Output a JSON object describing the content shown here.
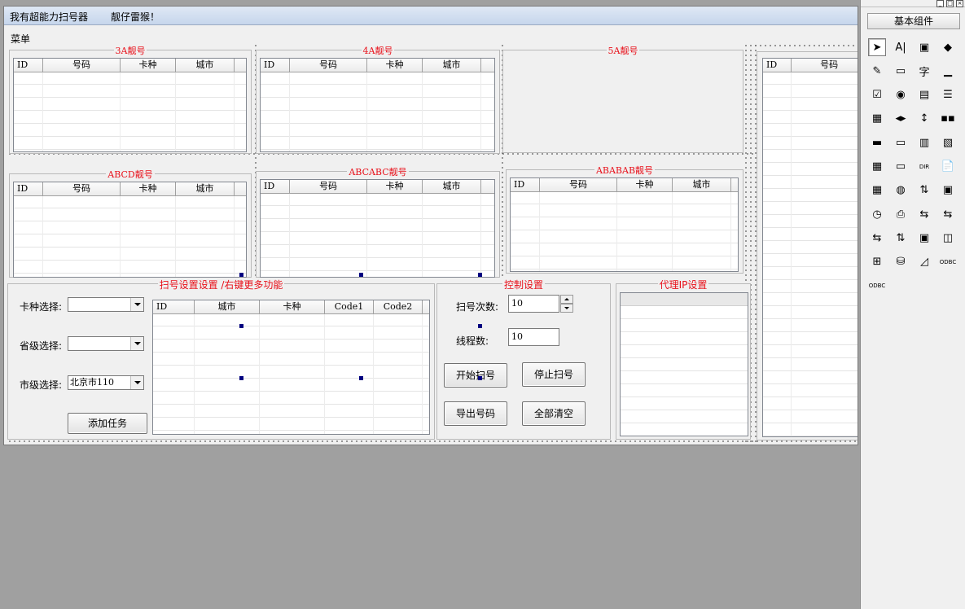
{
  "window": {
    "title": "我有超能力扫号器",
    "subtitle": "靓仔雷猴！"
  },
  "menu": {
    "label": "菜单"
  },
  "groups": {
    "g3a": "3A靓号",
    "g4a": "4A靓号",
    "g5a": "5A靓号",
    "gabcd": "ABCD靓号",
    "gabcabc": "ABCABC靓号",
    "gababab": "ABABAB靓号",
    "settings": "扫号设置设置 /右键更多功能",
    "control": "控制设置",
    "proxy": "代理IP设置"
  },
  "columns": {
    "number_table": [
      "ID",
      "号码",
      "卡种",
      "城市"
    ],
    "task_table": [
      "ID",
      "城市",
      "卡种",
      "Code1",
      "Code2"
    ],
    "right_table": [
      "ID",
      "号码"
    ]
  },
  "settings": {
    "card_label": "卡种选择:",
    "card_value": "",
    "province_label": "省级选择:",
    "province_value": "",
    "city_label": "市级选择:",
    "city_value": "北京市110",
    "add_task": "添加任务"
  },
  "control": {
    "scan_count_label": "扫号次数:",
    "scan_count_value": "10",
    "threads_label": "线程数:",
    "threads_value": "10",
    "start": "开始扫号",
    "stop": "停止扫号",
    "export": "导出号码",
    "clear": "全部清空"
  },
  "toolbox": {
    "header": "基本组件",
    "tools": [
      "pointer-icon",
      "label-icon",
      "image-icon",
      "shape-icon",
      "edit-icon",
      "groupbox-icon",
      "font-icon",
      "line-icon",
      "checkbox-icon",
      "radio-icon",
      "listbox-icon",
      "listview-icon",
      "treeview-icon",
      "hscroll-icon",
      "vscroll-icon",
      "progress-icon",
      "slider-icon",
      "tab-icon",
      "tabs-icon",
      "browser-icon",
      "calendar-icon",
      "dropdown-icon",
      "dir-icon",
      "file-icon",
      "grid-icon",
      "network-icon",
      "spin-icon",
      "status-icon",
      "timer-icon",
      "printer-icon",
      "client-icon",
      "server-icon",
      "transfer-icon",
      "link-icon",
      "panel-icon",
      "layout-icon",
      "db-table-icon",
      "db-icon",
      "chart-icon",
      "odbc-icon",
      "odbc-small-icon"
    ],
    "glyphs": [
      "➤",
      "A|",
      "▣",
      "◆",
      "✎",
      "▭",
      "字",
      "▁",
      "☑",
      "◉",
      "▤",
      "☰",
      "▦",
      "◂▸",
      "↕",
      "▪▪",
      "▬",
      "▭",
      "▥",
      "▧",
      "▦",
      "▭",
      "DIR",
      "📄",
      "▦",
      "◍",
      "⇅",
      "▣",
      "◷",
      "⎙",
      "⇆",
      "⇆",
      "⇆",
      "⇅",
      "▣",
      "◫",
      "⊞",
      "⛁",
      "◿",
      "ODBC",
      "ODBC"
    ]
  }
}
